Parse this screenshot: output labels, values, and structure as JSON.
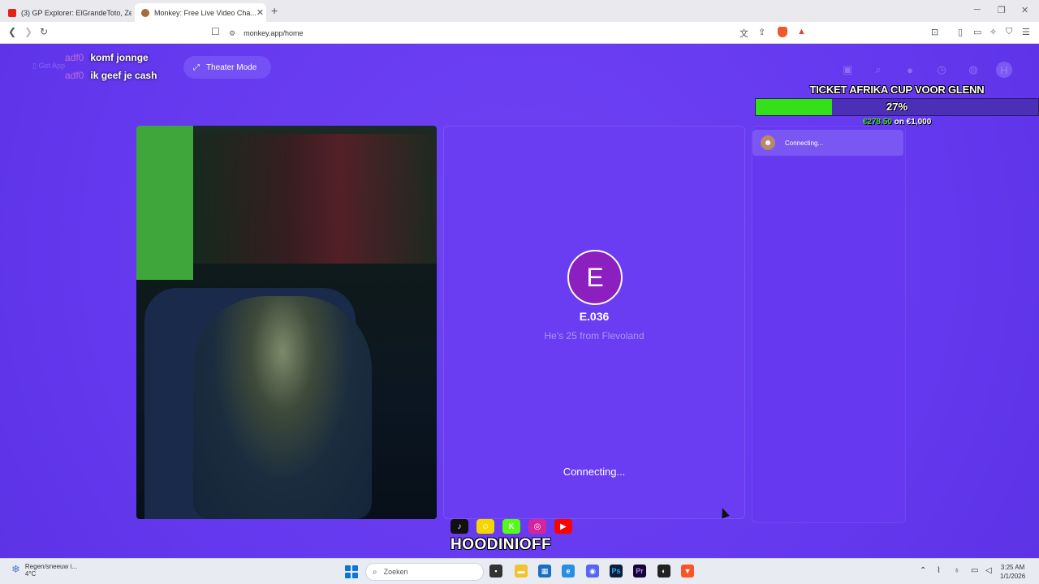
{
  "browser": {
    "tabs": [
      {
        "label": "(3) GP Explorer: ElGrandeToto, Zed, L...",
        "active": false,
        "favicon_color": "#e62117"
      },
      {
        "label": "Monkey: Free Live Video Cha...",
        "active": true,
        "favicon_color": "#a86a3c"
      }
    ],
    "url": "monkey.app/home",
    "new_tab": "+",
    "window_controls": {
      "minimize": "─",
      "maximize": "❐",
      "close": "✕"
    }
  },
  "chat": [
    {
      "user": "adf0",
      "message": "komf jonnge"
    },
    {
      "user": "adf0",
      "message": "ik geef je cash"
    }
  ],
  "header": {
    "get_app": "Get App",
    "theater_mode": "Theater Mode"
  },
  "donation": {
    "title": "TICKET AFRIKA CUP VOOR GLENN",
    "percent_label": "27%",
    "progress_fraction": 0.27,
    "raised": "€278.50",
    "goal_text": "on €1,000"
  },
  "stranger": {
    "initial": "E",
    "name": "E.036",
    "info": "He's 25 from Flevoland",
    "status": "Connecting..."
  },
  "side_panel": {
    "status": "Connecting..."
  },
  "streamer": {
    "handle": "HOODINIOFF",
    "socials": [
      {
        "name": "tiktok-icon",
        "glyph": "♪",
        "color": "#111111"
      },
      {
        "name": "snapchat-icon",
        "glyph": "☺",
        "color": "#f5d700"
      },
      {
        "name": "kick-icon",
        "glyph": "K",
        "color": "#53fc18"
      },
      {
        "name": "instagram-icon",
        "glyph": "◎",
        "color": "#d6249f"
      },
      {
        "name": "youtube-icon",
        "glyph": "▶",
        "color": "#ff0000"
      }
    ]
  },
  "taskbar": {
    "weather_text": "Regen/sneeuw i...",
    "weather_temp": "4°C",
    "search_placeholder": "Zoeken",
    "time": "3:25 AM",
    "date": "1/1/2026"
  }
}
